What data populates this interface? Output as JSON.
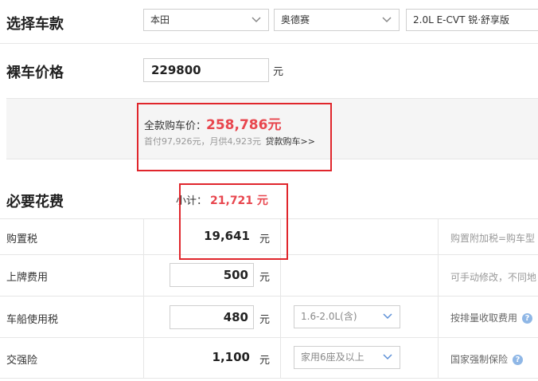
{
  "car_select": {
    "title": "选择车款",
    "brand": "本田",
    "series": "奥德赛",
    "model": "2.0L E-CVT 锐·舒享版"
  },
  "bare_price": {
    "title": "裸车价格",
    "value": "229800",
    "unit": "元"
  },
  "total": {
    "label": "全款购车价：",
    "amount": "258,786元",
    "detail": "首付97,926元，月供4,923元",
    "loan_link": "贷款购车>>"
  },
  "required_fees": {
    "title": "必要花费",
    "subtotal_label": "小计：",
    "subtotal_value": "21,721 元",
    "rows": [
      {
        "label": "购置税",
        "value": "19,641",
        "unit": "元",
        "hint": "购置附加税=购车型"
      },
      {
        "label": "上牌费用",
        "value": "500",
        "unit": "元",
        "hint": "可手动修改，不同地"
      },
      {
        "label": "车船使用税",
        "value": "480",
        "unit": "元",
        "option": "1.6-2.0L(含)",
        "hint": "按排量收取费用"
      },
      {
        "label": "交强险",
        "value": "1,100",
        "unit": "元",
        "option": "家用6座及以上",
        "hint": "国家强制保险"
      }
    ]
  },
  "colors": {
    "accent_red": "#e0262c",
    "price_red": "#e8464e",
    "border": "#e6e6e6",
    "help_blue": "#8fb7e6"
  }
}
